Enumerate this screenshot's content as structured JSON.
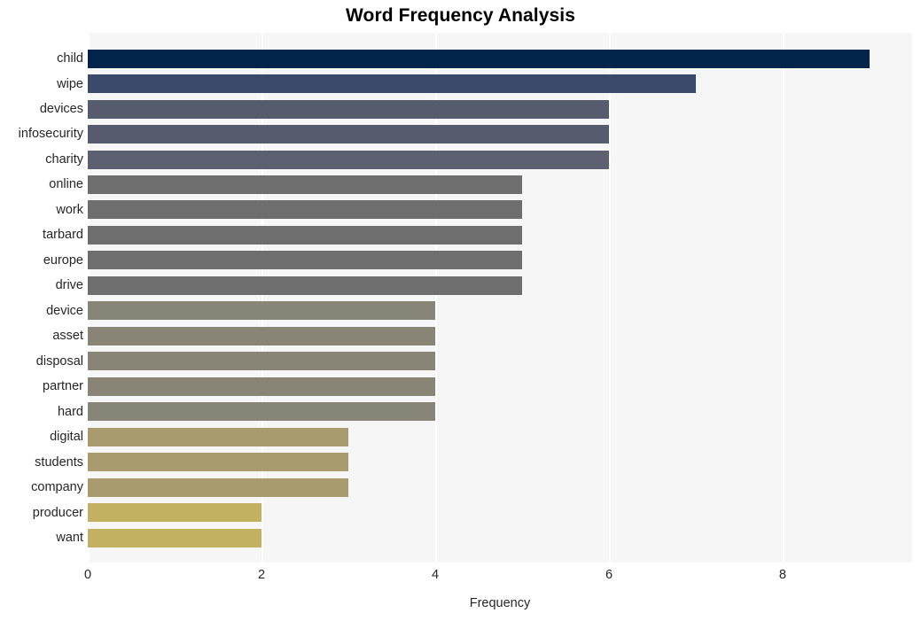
{
  "chart_data": {
    "type": "bar",
    "orientation": "horizontal",
    "title": "Word Frequency Analysis",
    "xlabel": "Frequency",
    "ylabel": "",
    "categories": [
      "child",
      "wipe",
      "devices",
      "infosecurity",
      "charity",
      "online",
      "work",
      "tarbard",
      "europe",
      "drive",
      "device",
      "asset",
      "disposal",
      "partner",
      "hard",
      "digital",
      "students",
      "company",
      "producer",
      "want"
    ],
    "values": [
      9,
      7,
      6,
      6,
      6,
      5,
      5,
      5,
      5,
      5,
      4,
      4,
      4,
      4,
      4,
      3,
      3,
      3,
      2,
      2
    ],
    "bar_colors": [
      "#03254c",
      "#3b4a6b",
      "#565c6e",
      "#565c6e",
      "#5c6070",
      "#6e6e6e",
      "#6e6e6e",
      "#6e6e6e",
      "#6e6e6e",
      "#6e6e6e",
      "#878578",
      "#888577",
      "#888577",
      "#888577",
      "#878578",
      "#a89b6d",
      "#a89b6d",
      "#a89b6d",
      "#c2b161",
      "#c2b161"
    ],
    "xlim": [
      0,
      9.49
    ],
    "xticks": [
      0,
      2,
      4,
      6,
      8
    ],
    "xticklabels": [
      "0",
      "2",
      "4",
      "6",
      "8"
    ],
    "grid": "vertical-white",
    "legend": "none",
    "plot_background": "#f6f6f7",
    "figure_background": "#ffffff"
  }
}
